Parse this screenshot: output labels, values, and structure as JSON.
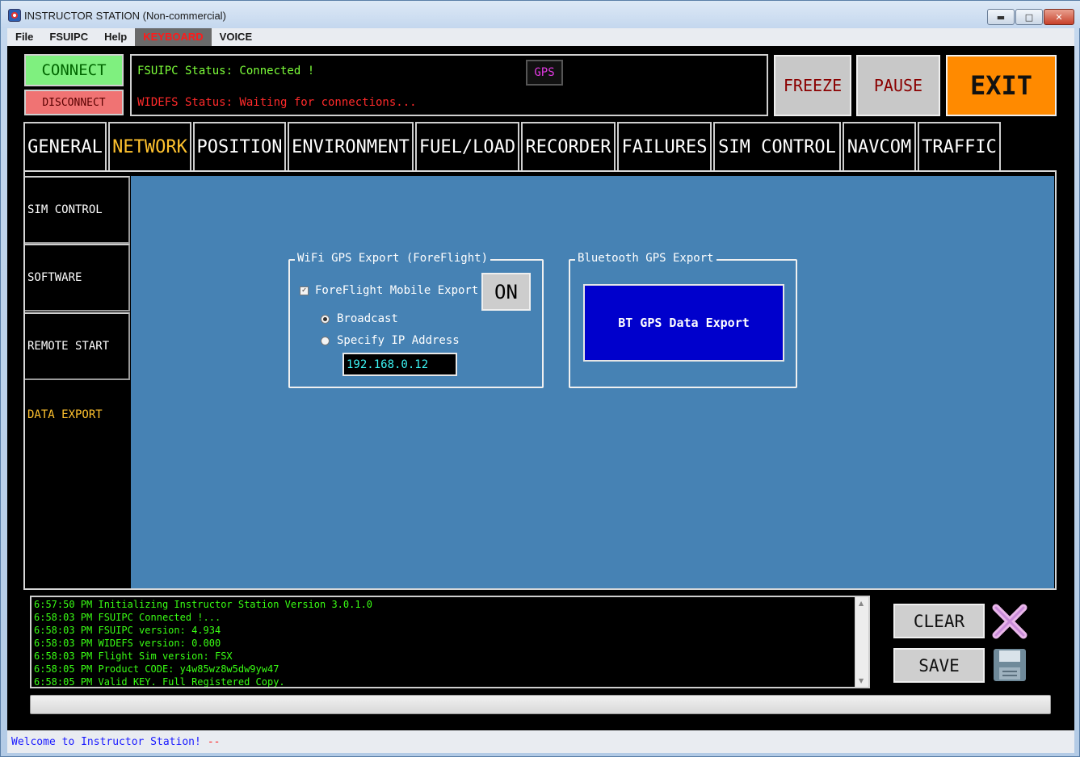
{
  "window": {
    "title": "INSTRUCTOR STATION (Non-commercial)",
    "controls": {
      "minimize": "▬",
      "maximize": "□",
      "close": "✕"
    }
  },
  "menu": [
    "File",
    "FSUIPC",
    "Help",
    "KEYBOARD",
    "VOICE"
  ],
  "top": {
    "connect": "CONNECT",
    "disconnect": "DISCONNECT",
    "fsuipc_status": "FSUIPC Status: Connected !",
    "widefs_status": "WIDEFS Status: Waiting for connections...",
    "gps": "GPS",
    "freeze": "FREEZE",
    "pause": "PAUSE",
    "exit": "EXIT"
  },
  "tabs": [
    {
      "label": "GENERAL",
      "active": false
    },
    {
      "label": "NETWORK",
      "active": true
    },
    {
      "label": "POSITION",
      "active": false
    },
    {
      "label": "ENVIRONMENT",
      "active": false
    },
    {
      "label": "FUEL/LOAD",
      "active": false
    },
    {
      "label": "RECORDER",
      "active": false
    },
    {
      "label": "FAILURES",
      "active": false
    },
    {
      "label": "SIM CONTROL",
      "active": false
    },
    {
      "label": "NAVCOM",
      "active": false
    },
    {
      "label": "TRAFFIC",
      "active": false
    }
  ],
  "sidebar": [
    {
      "label": "SIM CONTROL",
      "active": false
    },
    {
      "label": "SOFTWARE",
      "active": false
    },
    {
      "label": "REMOTE START",
      "active": false
    },
    {
      "label": "DATA EXPORT",
      "active": true
    }
  ],
  "wifi": {
    "legend": "WiFi GPS Export (ForeFlight)",
    "checkbox_label": "ForeFlight Mobile Export",
    "checkbox_checked": true,
    "toggle": "ON",
    "radio_broadcast": "Broadcast",
    "radio_specify": "Specify IP Address",
    "selected_radio": "broadcast",
    "ip_value": "192.168.0.12"
  },
  "bluetooth": {
    "legend": "Bluetooth GPS Export",
    "button": "BT GPS Data Export"
  },
  "log": [
    "6:57:50 PM Initializing Instructor Station Version 3.0.1.0",
    "6:58:03 PM FSUIPC Connected !...",
    "6:58:03 PM FSUIPC version: 4.934",
    "6:58:03 PM WIDEFS version: 0.000",
    "6:58:03 PM Flight Sim version: FSX",
    "6:58:05 PM Product CODE: y4w85wz8w5dw9yw47",
    "6:58:05 PM Valid KEY. Full Registered Copy."
  ],
  "log_buttons": {
    "clear": "CLEAR",
    "save": "SAVE"
  },
  "progress_fraction": 0.0,
  "statusbar": {
    "welcome": "Welcome to Instructor Station!",
    "suffix": "--"
  },
  "colors": {
    "active_tab": "#ffc22e",
    "connect_bg": "#7ff07f",
    "disconnect_bg": "#f07373",
    "exit_bg": "#ff8a00",
    "panel_bg": "#4682b4",
    "bt_button_bg": "#0000cc",
    "log_text": "#39ff14"
  },
  "icons": {
    "clear": "x-mark-icon",
    "save": "floppy-disk-icon"
  }
}
